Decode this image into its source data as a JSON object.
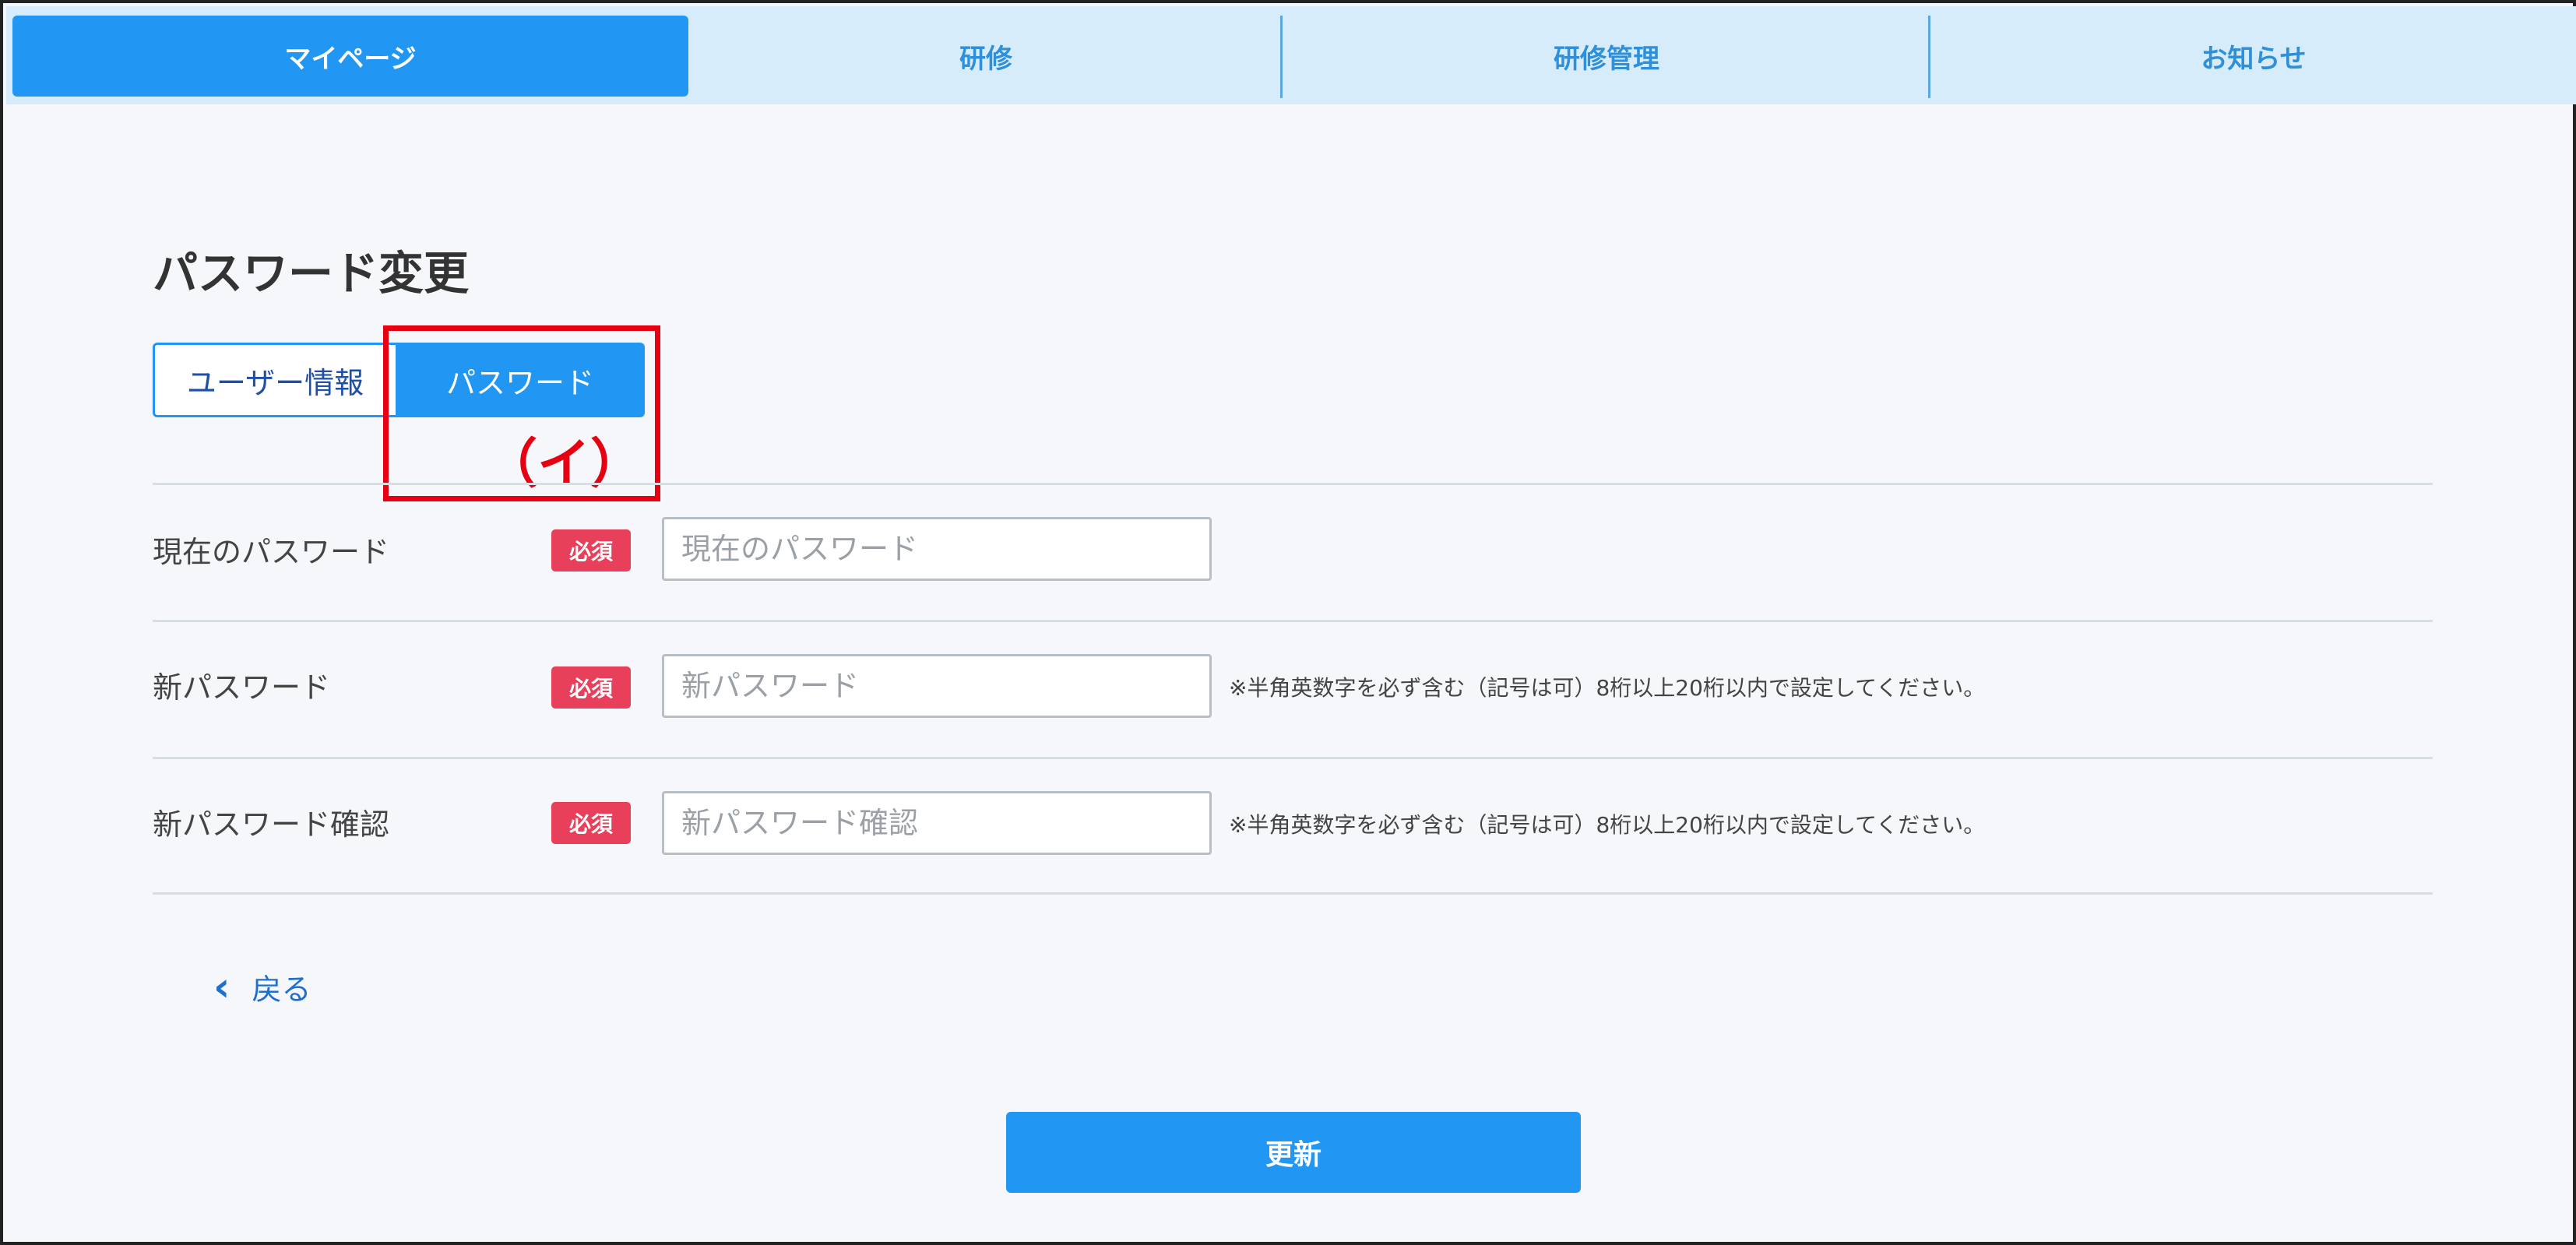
{
  "nav": {
    "tabs": [
      {
        "label": "マイページ",
        "active": true
      },
      {
        "label": "研修",
        "active": false
      },
      {
        "label": "研修管理",
        "active": false
      },
      {
        "label": "お知らせ",
        "active": false
      }
    ]
  },
  "page": {
    "title": "パスワード変更"
  },
  "segments": {
    "user_info": "ユーザー情報",
    "password": "パスワード"
  },
  "annotation": {
    "label": "（イ）"
  },
  "form": {
    "rows": [
      {
        "label": "現在のパスワード",
        "required": "必須",
        "placeholder": "現在のパスワード",
        "value": "",
        "note": ""
      },
      {
        "label": "新パスワード",
        "required": "必須",
        "placeholder": "新パスワード",
        "value": "",
        "note": "※半角英数字を必ず含む（記号は可）8桁以上20桁以内で設定してください。"
      },
      {
        "label": "新パスワード確認",
        "required": "必須",
        "placeholder": "新パスワード確認",
        "value": "",
        "note": "※半角英数字を必ず含む（記号は可）8桁以上20桁以内で設定してください。"
      }
    ]
  },
  "actions": {
    "back_label": "戻る",
    "back_icon": "chevron-left-icon",
    "submit_label": "更新"
  },
  "colors": {
    "primary": "#2196f3",
    "nav_bg": "#d6ecfb",
    "required_badge": "#e8405a",
    "annotation": "#e60012",
    "page_bg": "#f5f7fa"
  }
}
